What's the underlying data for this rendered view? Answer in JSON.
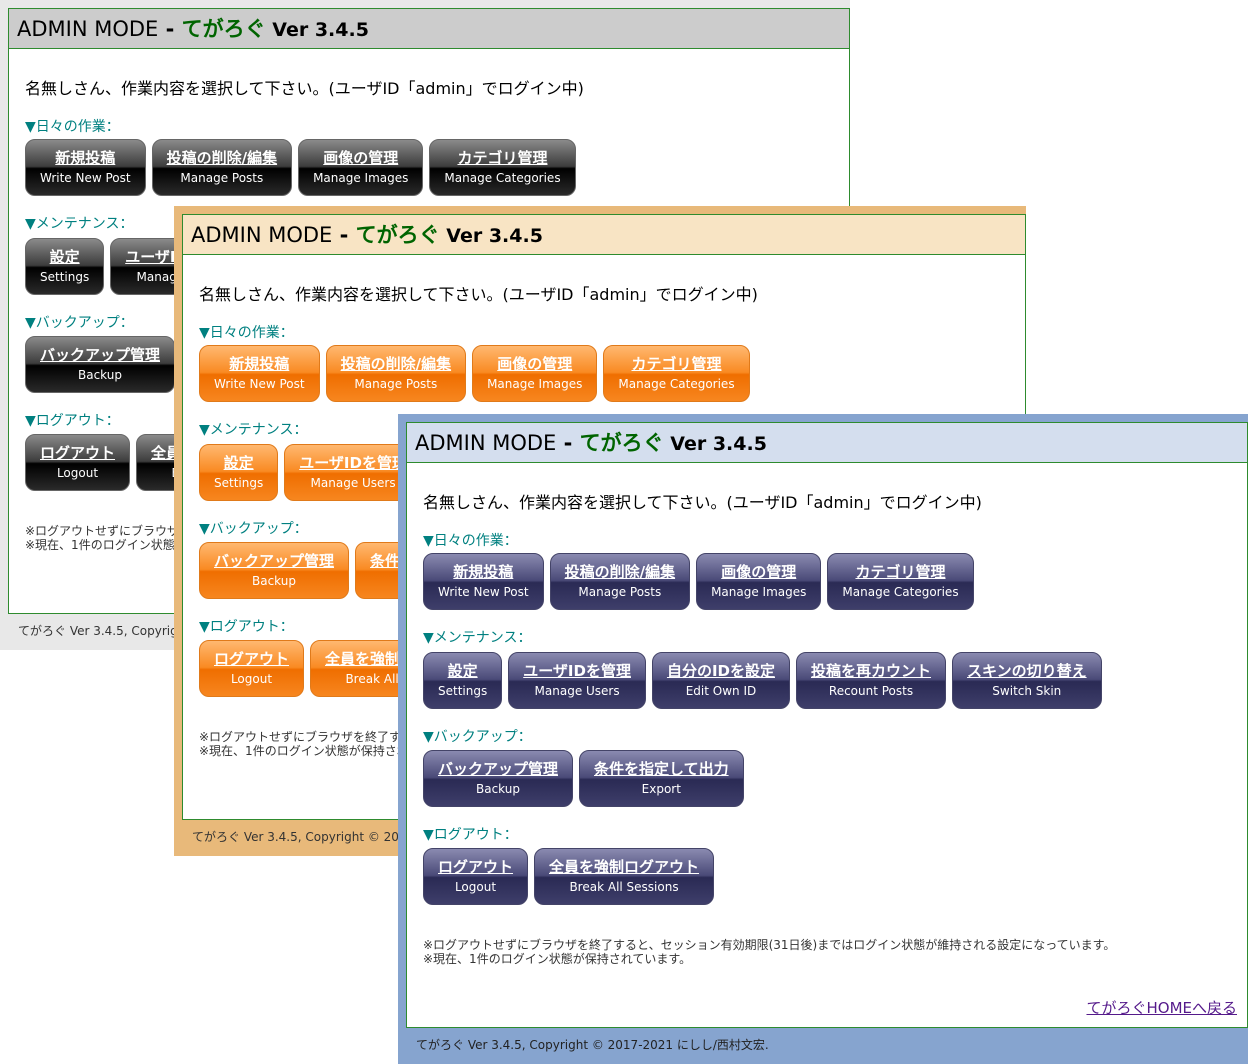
{
  "admin_panel": {
    "title_admin": "ADMIN MODE",
    "title_sep": " - ",
    "title_app": "てがろぐ",
    "title_version": " Ver 3.4.5",
    "greeting": "名無しさん、作業内容を選択して下さい。(ユーザID「admin」でログイン中)",
    "sections": {
      "daily": "▼日々の作業：",
      "maintenance": "▼メンテナンス：",
      "backup": "▼バックアップ：",
      "logout": "▼ログアウト："
    },
    "buttons": {
      "write_new_post": {
        "ja": "新規投稿",
        "en": "Write New Post"
      },
      "manage_posts": {
        "ja": "投稿の削除/編集",
        "en": "Manage Posts"
      },
      "manage_images": {
        "ja": "画像の管理",
        "en": "Manage Images"
      },
      "manage_categories": {
        "ja": "カテゴリ管理",
        "en": "Manage Categories"
      },
      "settings": {
        "ja": "設定",
        "en": "Settings"
      },
      "manage_users": {
        "ja": "ユーザIDを管理",
        "en": "Manage Users"
      },
      "edit_own_id": {
        "ja": "自分のIDを設定",
        "en": "Edit Own ID"
      },
      "recount_posts": {
        "ja": "投稿を再カウント",
        "en": "Recount Posts"
      },
      "switch_skin": {
        "ja": "スキンの切り替え",
        "en": "Switch Skin"
      },
      "backup": {
        "ja": "バックアップ管理",
        "en": "Backup"
      },
      "export": {
        "ja": "条件を指定して出力",
        "en": "Export"
      },
      "logout": {
        "ja": "ログアウト",
        "en": "Logout"
      },
      "break_sessions": {
        "ja": "全員を強制ログアウト",
        "en": "Break All Sessions"
      }
    },
    "note_line1": "※ログアウトせずにブラウザを終了すると、セッション有効期限(31日後)まではログイン状態が維持される設定になっています。",
    "note_line2": "※現在、1件のログイン状態が保持されています。",
    "home_link": "てがろぐHOMEへ戻る",
    "footer": "てがろぐ Ver 3.4.5, Copyright © 2017-2021 にしし/西村文宏."
  },
  "themes": {
    "black": "#000000",
    "orange": "#f98a22",
    "navy": "#2a2a54"
  }
}
